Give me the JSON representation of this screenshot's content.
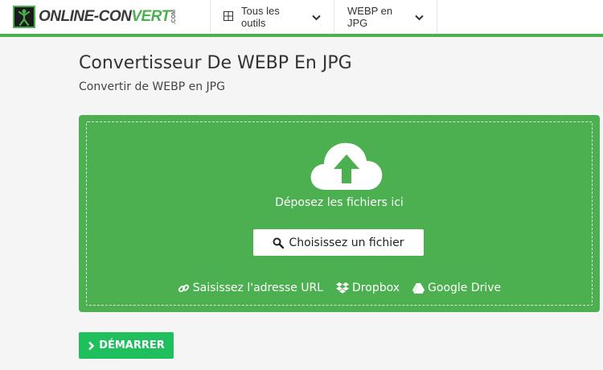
{
  "header": {
    "logo": {
      "part1": "ONLINE-CON",
      "part2": "VERT",
      "suffix": ".COM"
    },
    "nav": {
      "tools_label": "Tous les outils",
      "format_label": "WEBP en JPG"
    }
  },
  "main": {
    "title": "Convertisseur De WEBP En JPG",
    "subtitle": "Convertir de WEBP en JPG",
    "dropzone": {
      "text": "Déposez les fichiers ici",
      "choose_label": "Choisissez un fichier",
      "sources": {
        "url": "Saisissez l'adresse URL",
        "dropbox": "Dropbox",
        "gdrive": "Google Drive"
      }
    },
    "start_label": "DÉMARRER"
  },
  "colors": {
    "accent": "#4caf50",
    "start": "#1fbf5d"
  },
  "icons": [
    "grid-icon",
    "chevron-down-icon",
    "upload-cloud-icon",
    "search-icon",
    "link-icon",
    "dropbox-icon",
    "google-drive-icon",
    "chevron-right-icon"
  ]
}
